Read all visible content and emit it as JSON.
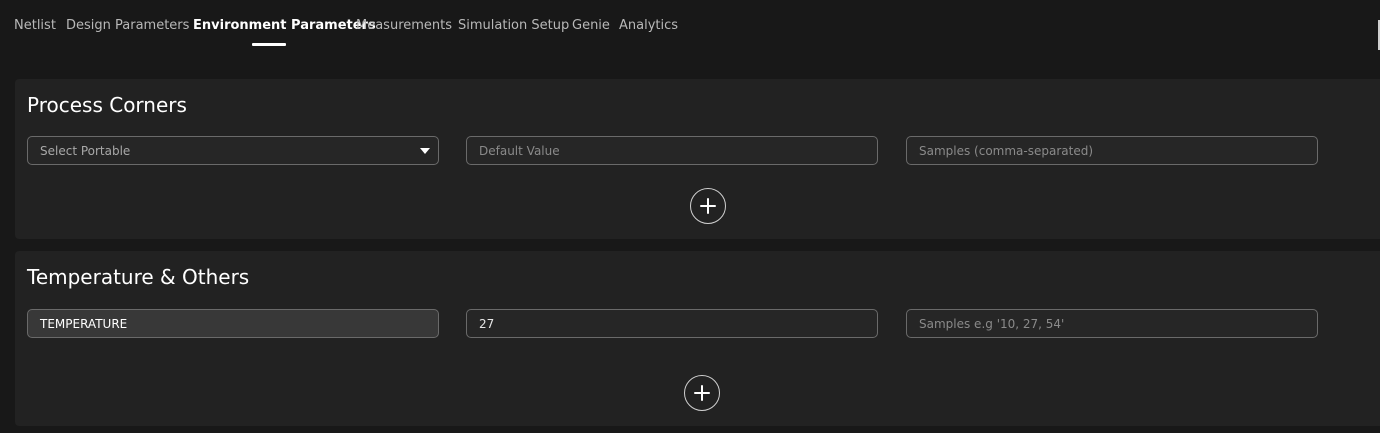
{
  "nav": {
    "tabs": [
      {
        "label": "Netlist",
        "active": false
      },
      {
        "label": "Design Parameters",
        "active": false
      },
      {
        "label": "Environment Parameters",
        "active": true
      },
      {
        "label": "Measurements",
        "active": false
      },
      {
        "label": "Simulation Setup",
        "active": false
      },
      {
        "label": "Genie",
        "active": false
      },
      {
        "label": "Analytics",
        "active": false
      }
    ]
  },
  "process_corners": {
    "title": "Process Corners",
    "select_placeholder": "Select Portable",
    "default_value_placeholder": "Default Value",
    "samples_placeholder": "Samples (comma-separated)",
    "add_icon": "plus-circle-icon"
  },
  "temperature": {
    "title": "Temperature & Others",
    "name_value": "TEMPERATURE",
    "default_value": "27",
    "samples_placeholder": "Samples e.g '10, 27, 54'",
    "add_icon": "plus-circle-icon"
  },
  "colors": {
    "background": "#181818",
    "panel": "#222222",
    "field_border": "#6a6a6a",
    "active_tab": "#ffffff",
    "inactive_tab": "#b8b8b8"
  }
}
